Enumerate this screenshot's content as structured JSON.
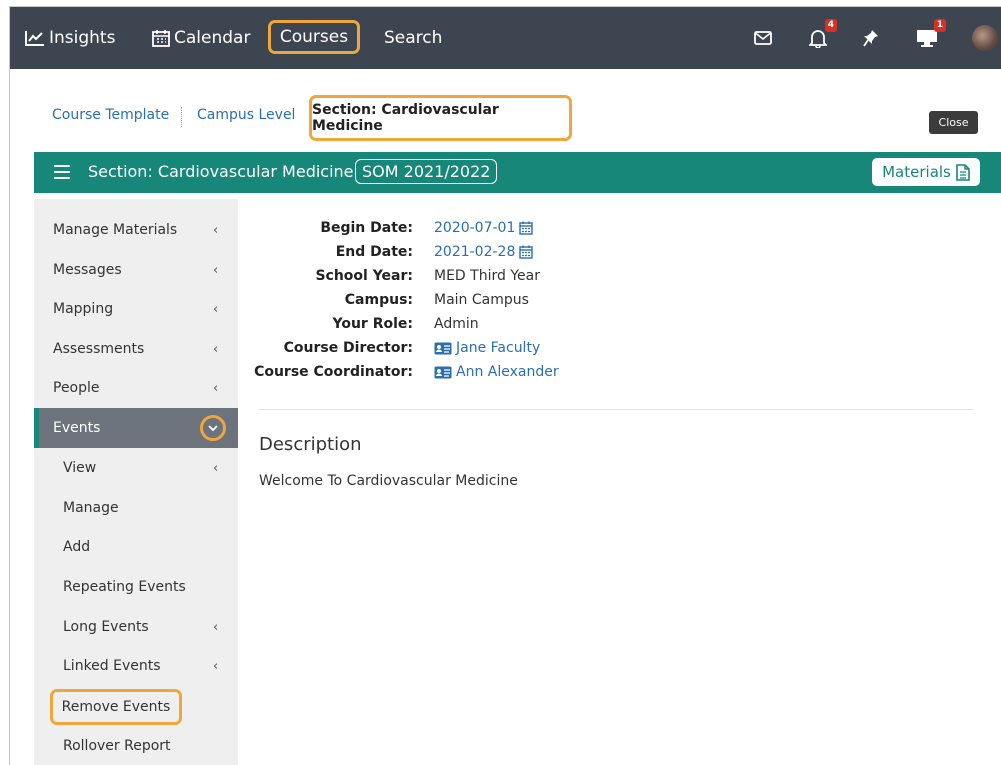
{
  "nav": {
    "insights": "Insights",
    "calendar": "Calendar",
    "courses": "Courses",
    "search": "Search",
    "notifications_count": "4",
    "screen_count": "1"
  },
  "breadcrumb": {
    "course_template": "Course Template",
    "campus_level": "Campus Level",
    "section": "Section: Cardiovascular Medicine"
  },
  "close_label": "Close",
  "header": {
    "title": "Section: Cardiovascular Medicine",
    "year": "SOM 2021/2022",
    "materials": "Materials"
  },
  "sidebar": {
    "items": [
      {
        "label": "Manage Materials",
        "chevron": "‹"
      },
      {
        "label": "Messages",
        "chevron": "‹"
      },
      {
        "label": "Mapping",
        "chevron": "‹"
      },
      {
        "label": "Assessments",
        "chevron": "‹"
      },
      {
        "label": "People",
        "chevron": "‹"
      },
      {
        "label": "Events"
      }
    ],
    "sub_items": [
      {
        "label": "View",
        "chevron": "‹"
      },
      {
        "label": "Manage"
      },
      {
        "label": "Add"
      },
      {
        "label": "Repeating Events"
      },
      {
        "label": "Long Events",
        "chevron": "‹"
      },
      {
        "label": "Linked Events",
        "chevron": "‹"
      },
      {
        "label": "Remove Events"
      },
      {
        "label": "Rollover Report"
      }
    ]
  },
  "info": {
    "begin_label": "Begin Date:",
    "begin_value": "2020-07-01",
    "end_label": "End Date:",
    "end_value": "2021-02-28",
    "year_label": "School Year:",
    "year_value": "MED Third Year",
    "campus_label": "Campus:",
    "campus_value": "Main Campus",
    "role_label": "Your Role:",
    "role_value": "Admin",
    "director_label": "Course Director:",
    "director_value": "Jane Faculty",
    "coordinator_label": "Course Coordinator:",
    "coordinator_value": "Ann Alexander"
  },
  "description": {
    "heading": "Description",
    "text": "Welcome To Cardiovascular Medicine"
  },
  "colors": {
    "topbar": "#3d4650",
    "teal": "#17877a",
    "highlight": "#f0a63a",
    "link": "#2a6fb0"
  }
}
